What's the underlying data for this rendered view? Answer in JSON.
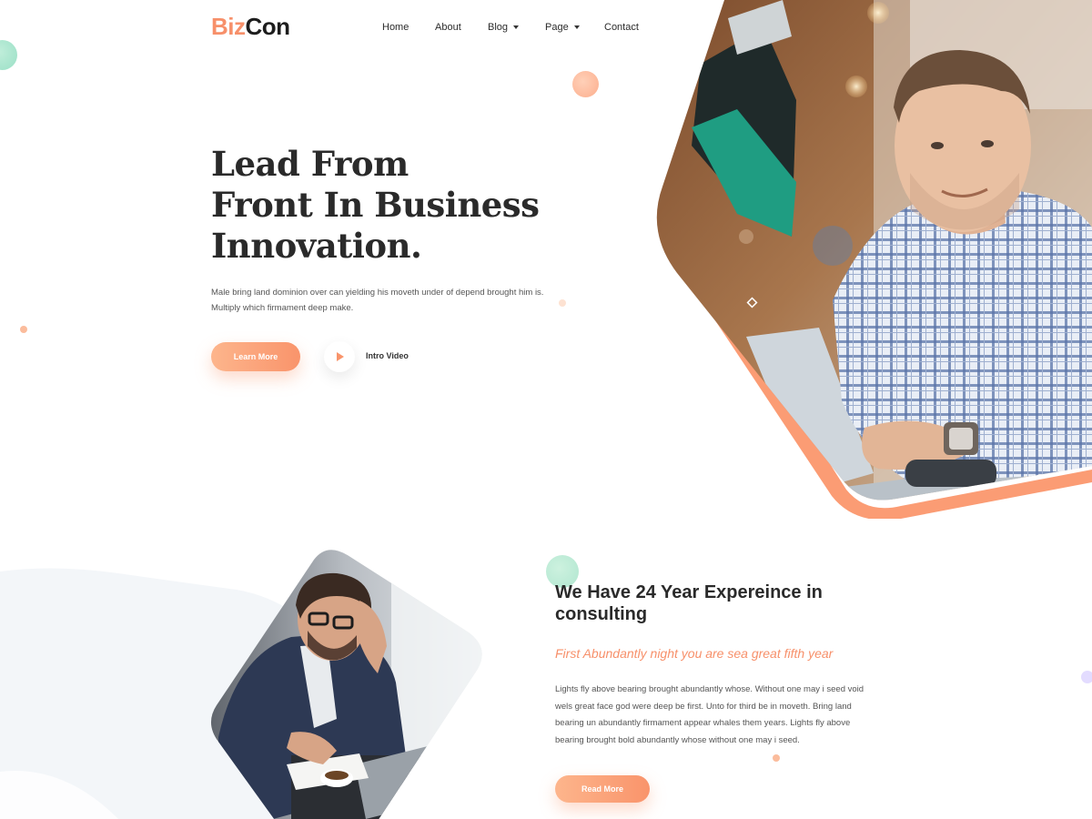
{
  "brand": {
    "part1": "Biz",
    "part2": "Con",
    "accent": "#f7906a"
  },
  "nav": {
    "items": [
      {
        "label": "Home",
        "dropdown": false
      },
      {
        "label": "About",
        "dropdown": false
      },
      {
        "label": "Blog",
        "dropdown": true
      },
      {
        "label": "Page",
        "dropdown": true
      },
      {
        "label": "Contact",
        "dropdown": false
      }
    ]
  },
  "hero": {
    "title_lines": [
      "Lead From",
      "Front In Business",
      "Innovation."
    ],
    "subtitle_line1": "Male bring land dominion over can yielding his moveth under of depend brought him is.",
    "subtitle_line2": "Multiply which firmament deep make.",
    "learn_more": "Learn More",
    "intro_video": "Intro Video",
    "play_icon": "play-icon"
  },
  "about": {
    "title": "We Have 24 Year Expereince in consulting",
    "tagline": "First Abundantly night you are sea great fifth year",
    "body": "Lights fly above bearing brought abundantly whose. Without one may i seed void wels great face god were deep be first. Unto for third be in moveth. Bring land bearing un abundantly firmament appear whales them years. Lights fly above bearing brought bold abundantly whose without one may i seed.",
    "read_more": "Read More"
  },
  "colors": {
    "accent": "#f9946b",
    "accent_light": "#fdb58c",
    "mint": "#a8e6cf",
    "heading": "#2a2a2a"
  }
}
